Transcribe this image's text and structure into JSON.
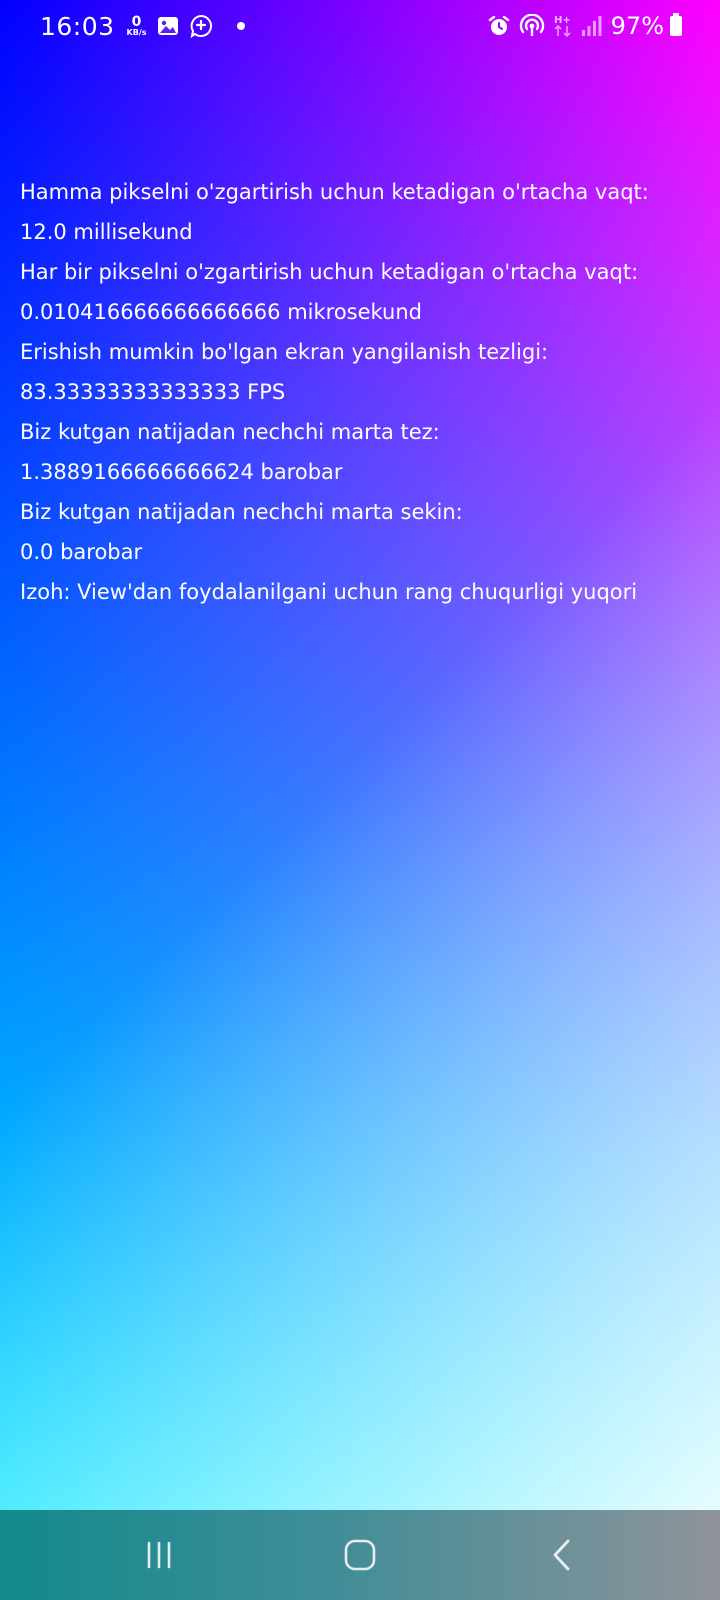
{
  "status_bar": {
    "time": "16:03",
    "net_speed_value": "0",
    "net_speed_unit": "KB/s",
    "battery_percent": "97%",
    "left_icons": [
      "gallery-icon",
      "messenger-icon",
      "notification-dot-icon"
    ],
    "right_icons": [
      "alarm-icon",
      "hotspot-icon",
      "hplus-data-icon",
      "signal-icon",
      "battery-icon"
    ]
  },
  "content": {
    "lines": [
      "Hamma pikselni o'zgartirish uchun ketadigan o'rtacha vaqt:",
      "12.0 millisekund",
      "Har bir pikselni o'zgartirish uchun ketadigan o'rtacha vaqt:",
      "0.010416666666666666 mikrosekund",
      "Erishish mumkin bo'lgan ekran yangilanish tezligi:",
      "83.33333333333333 FPS",
      "Biz kutgan natijadan nechchi marta tez:",
      "1.3889166666666624 barobar",
      "Biz kutgan natijadan nechchi marta sekin:",
      "0.0 barobar",
      "Izoh: View'dan foydalanilgani uchun rang chuqurligi yuqori"
    ]
  },
  "colors": {
    "gradient_top_left": "#0000ff",
    "gradient_top_right": "#ff00ff",
    "gradient_bottom_left": "#00f0ff",
    "gradient_bottom_right": "#ffffff",
    "text": "#ffffff"
  },
  "nav_bar": {
    "buttons": [
      "recents-icon",
      "home-icon",
      "back-icon"
    ]
  }
}
